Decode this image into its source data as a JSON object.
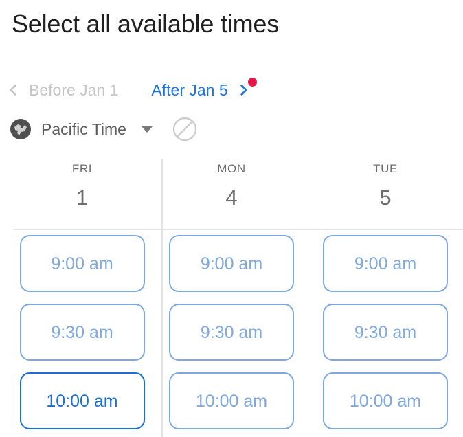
{
  "title": "Select all available times",
  "colors": {
    "accent_blue": "#1a73e8",
    "slot_blue": "#7fa9de",
    "slot_active_blue": "#1a6fd4",
    "badge_red": "#e8174a",
    "muted_gray": "#6e6e6e",
    "disabled_gray": "#c6c6c6"
  },
  "nav": {
    "prev_label": "Before Jan 1",
    "prev_icon": "chevron-left-icon",
    "prev_enabled": false,
    "next_label": "After Jan 5",
    "next_icon": "chevron-right-icon",
    "next_enabled": true,
    "badge_visible": true
  },
  "timezone": {
    "icon": "globe-icon",
    "label": "Pacific Time",
    "caret_icon": "chevron-down-icon",
    "blocked_icon": "prohibited-icon"
  },
  "calendar": {
    "columns": [
      {
        "day_name": "FRI",
        "day_number": "1",
        "slots": [
          {
            "label": "9:00 am",
            "selected": false
          },
          {
            "label": "9:30 am",
            "selected": false
          },
          {
            "label": "10:00 am",
            "selected": true
          }
        ]
      },
      {
        "day_name": "MON",
        "day_number": "4",
        "slots": [
          {
            "label": "9:00 am",
            "selected": false
          },
          {
            "label": "9:30 am",
            "selected": false
          },
          {
            "label": "10:00 am",
            "selected": false
          }
        ]
      },
      {
        "day_name": "TUE",
        "day_number": "5",
        "slots": [
          {
            "label": "9:00 am",
            "selected": false
          },
          {
            "label": "9:30 am",
            "selected": false
          },
          {
            "label": "10:00 am",
            "selected": false
          }
        ]
      }
    ]
  }
}
